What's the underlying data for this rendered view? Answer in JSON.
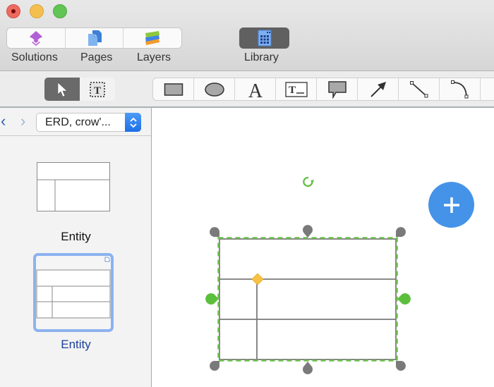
{
  "window": {
    "traffic_lights": [
      "close",
      "minimize",
      "maximize"
    ]
  },
  "top_toolbar": {
    "segments": [
      {
        "label": "Solutions",
        "icon": "solutions-icon"
      },
      {
        "label": "Pages",
        "icon": "pages-icon"
      },
      {
        "label": "Layers",
        "icon": "layers-icon"
      }
    ],
    "library": {
      "label": "Library",
      "icon": "library-icon",
      "active": true
    }
  },
  "mode_toolbar": {
    "items": [
      {
        "name": "select-tool",
        "icon": "pointer-icon",
        "active": true
      },
      {
        "name": "text-select-tool",
        "icon": "text-box-select-icon",
        "active": false
      }
    ]
  },
  "shape_toolbar": {
    "items": [
      {
        "name": "rectangle-tool",
        "icon": "rectangle-icon"
      },
      {
        "name": "ellipse-tool",
        "icon": "ellipse-icon"
      },
      {
        "name": "text-tool",
        "icon": "text-icon",
        "glyph": "A"
      },
      {
        "name": "text-block-tool",
        "icon": "text-block-icon",
        "glyph": "T"
      },
      {
        "name": "callout-tool",
        "icon": "callout-icon"
      },
      {
        "name": "arrow-tool",
        "icon": "arrow-icon"
      },
      {
        "name": "line-tool",
        "icon": "line-icon"
      },
      {
        "name": "arc-tool",
        "icon": "arc-icon"
      }
    ]
  },
  "sidebar": {
    "nav": {
      "back": "‹",
      "forward": "›"
    },
    "library_select": {
      "value": "ERD, crow'..."
    },
    "items": [
      {
        "label": "Entity",
        "selected": false
      },
      {
        "label": "Entity",
        "selected": true
      }
    ]
  },
  "canvas": {
    "selected_shape": "entity",
    "add_button": "+",
    "colors": {
      "selection": "#6cc04a",
      "handle": "#7a7a7a",
      "control_point": "#f7c244",
      "fab": "#4593e8"
    }
  }
}
